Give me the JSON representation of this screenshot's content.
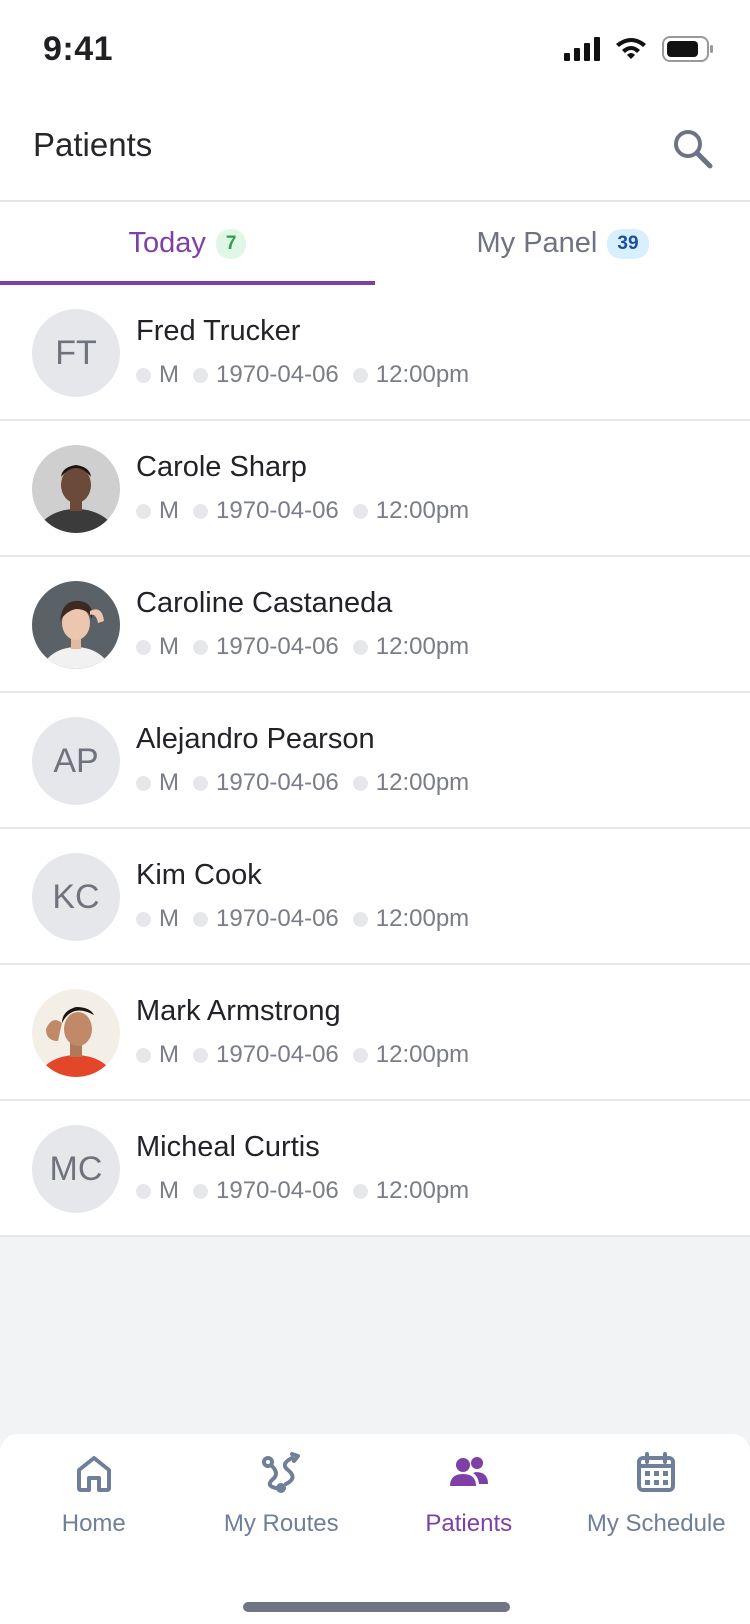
{
  "status_bar": {
    "time": "9:41"
  },
  "header": {
    "title": "Patients"
  },
  "tabs": [
    {
      "label": "Today",
      "count": "7"
    },
    {
      "label": "My Panel",
      "count": "39"
    }
  ],
  "patients": [
    {
      "name": "Fred Trucker",
      "initials": "FT",
      "sex": "M",
      "dob": "1970-04-06",
      "time": "12:00pm"
    },
    {
      "name": "Carole Sharp",
      "initials": "",
      "sex": "M",
      "dob": "1970-04-06",
      "time": "12:00pm"
    },
    {
      "name": "Caroline Castaneda",
      "initials": "",
      "sex": "M",
      "dob": "1970-04-06",
      "time": "12:00pm"
    },
    {
      "name": "Alejandro Pearson",
      "initials": "AP",
      "sex": "M",
      "dob": "1970-04-06",
      "time": "12:00pm"
    },
    {
      "name": "Kim Cook",
      "initials": "KC",
      "sex": "M",
      "dob": "1970-04-06",
      "time": "12:00pm"
    },
    {
      "name": "Mark Armstrong",
      "initials": "",
      "sex": "M",
      "dob": "1970-04-06",
      "time": "12:00pm"
    },
    {
      "name": "Micheal Curtis",
      "initials": "MC",
      "sex": "M",
      "dob": "1970-04-06",
      "time": "12:00pm"
    }
  ],
  "bottom_nav": [
    {
      "label": "Home",
      "icon": "home-icon"
    },
    {
      "label": "My Routes",
      "icon": "route-icon"
    },
    {
      "label": "Patients",
      "icon": "users-icon"
    },
    {
      "label": "My Schedule",
      "icon": "calendar-icon"
    }
  ],
  "colors": {
    "accent": "#7e3fa6",
    "nav_inactive": "#6f7e99"
  }
}
